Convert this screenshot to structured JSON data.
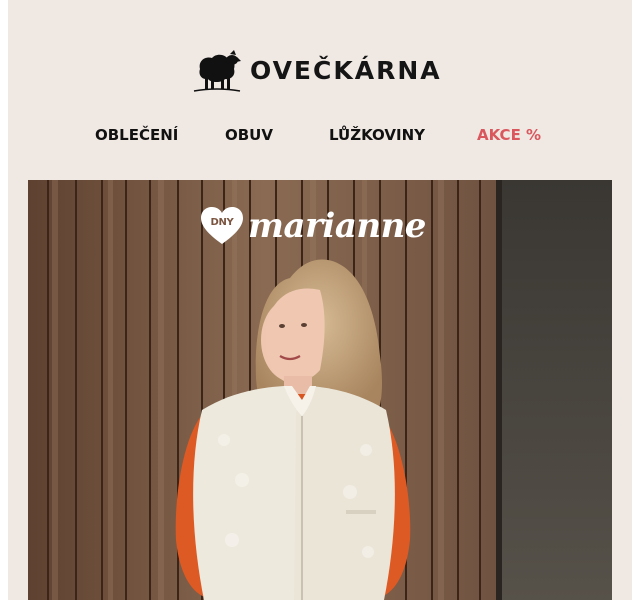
{
  "brand": {
    "name": "OVEČKÁRNA",
    "icon": "sheep-icon"
  },
  "nav": {
    "items": [
      {
        "label": "OBLEČENÍ"
      },
      {
        "label": "OBUV"
      },
      {
        "label": "LŮŽKOVINY"
      },
      {
        "label": "AKCE %"
      }
    ]
  },
  "hero": {
    "badge_heart_text": "DNY",
    "badge_word": "marianne",
    "image": "woman-in-wool-vest-photo"
  },
  "colors": {
    "background": "#efe8e3",
    "text": "#111111",
    "sale": "#d9575d"
  }
}
